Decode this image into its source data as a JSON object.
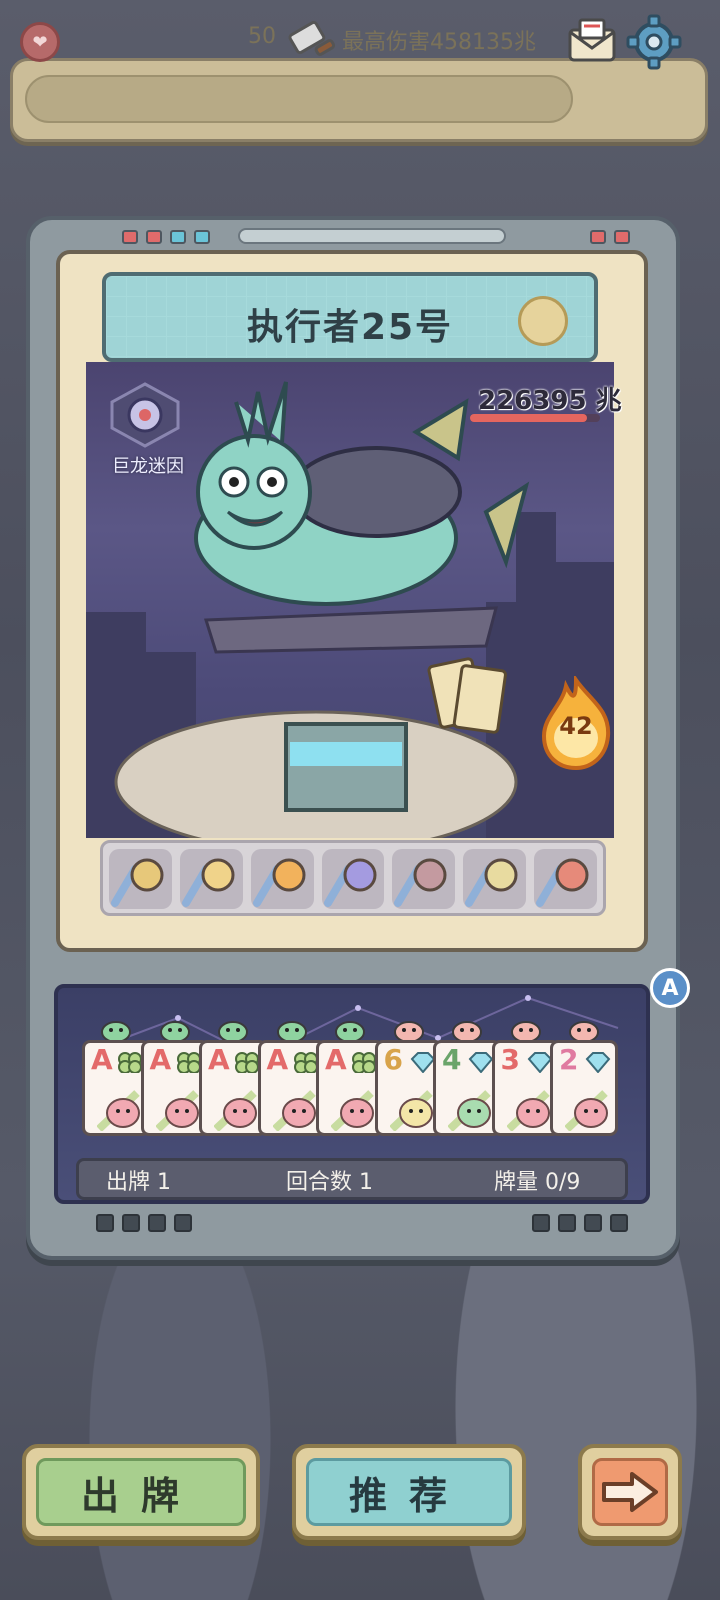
{
  "topbar": {
    "coins": "50",
    "max_damage_text": "最高伤害458135兆"
  },
  "boss": {
    "name": "执行者25号",
    "hp_text": "226395 兆",
    "hp_fraction": 0.9,
    "meme_label": "巨龙迷因"
  },
  "fire_count": "42",
  "relics": [
    "ring-relic",
    "shell-relic",
    "feather-relic",
    "crystal-relic",
    "bow-relic",
    "card-relic",
    "staff-relic"
  ],
  "auto_button": "A",
  "hand": [
    {
      "rank": "A",
      "rank_color": "#e36a6a",
      "suit": "clover-icon",
      "head": "frog-head-icon",
      "face": "pig-face-icon"
    },
    {
      "rank": "A",
      "rank_color": "#e36a6a",
      "suit": "clover-icon",
      "head": "frog-head-icon",
      "face": "pig-face-icon"
    },
    {
      "rank": "A",
      "rank_color": "#e36a6a",
      "suit": "clover-icon",
      "head": "frog-head-icon",
      "face": "pig-face-icon"
    },
    {
      "rank": "A",
      "rank_color": "#e36a6a",
      "suit": "clover-icon",
      "head": "frog-head-icon",
      "face": "pig-face-icon"
    },
    {
      "rank": "A",
      "rank_color": "#e36a6a",
      "suit": "clover-icon",
      "head": "frog-head-icon",
      "face": "pig-face-icon"
    },
    {
      "rank": "6",
      "rank_color": "#d8a34a",
      "suit": "diamond-icon",
      "head": "pig-head-icon",
      "face": "angel-face-icon"
    },
    {
      "rank": "4",
      "rank_color": "#6aa46a",
      "suit": "diamond-icon",
      "head": "pig-head-icon",
      "face": "frog-face-icon"
    },
    {
      "rank": "3",
      "rank_color": "#e36a6a",
      "suit": "diamond-icon",
      "head": "pig-head-icon",
      "face": "pig-face-icon"
    },
    {
      "rank": "2",
      "rank_color": "#e07aa0",
      "suit": "diamond-icon",
      "head": "pig-head-icon",
      "face": "pink-pig-face-icon"
    }
  ],
  "status": {
    "play_label": "出牌",
    "play_count": "1",
    "round_label": "回合数",
    "round_count": "1",
    "deck_label": "牌量",
    "deck_count": "0/9"
  },
  "buttons": {
    "play": "出牌",
    "recommend": "推荐"
  },
  "colors": {
    "hp_bar": "#e5665f",
    "play_button": "#a8cf8e",
    "recommend_button": "#8fd0d0",
    "next_button": "#ef9a70"
  }
}
